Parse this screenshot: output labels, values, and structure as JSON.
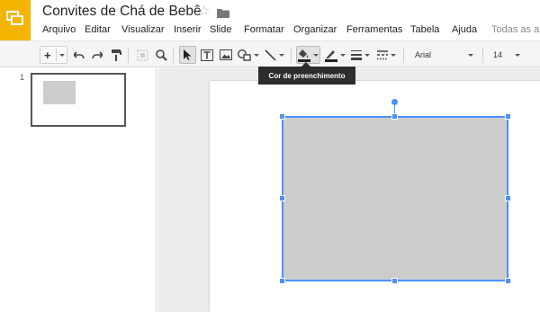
{
  "app": {
    "title": "Convites de Chá de Bebê"
  },
  "menu": {
    "items": [
      "Arquivo",
      "Editar",
      "Visualizar",
      "Inserir",
      "Slide",
      "Formatar",
      "Organizar",
      "Ferramentas",
      "Tabela",
      "Ajuda"
    ],
    "changes_status": "Todas as al"
  },
  "toolbar": {
    "add_label": "+",
    "font_name": "Arial",
    "font_size": "14"
  },
  "tooltip": {
    "text": "Cor de preenchimento"
  },
  "filmstrip": {
    "slide_number": "1"
  },
  "colors": {
    "accent": "#4d90fe",
    "logo": "#f4b400",
    "shape_fill": "#cdcdcd"
  },
  "icons": [
    "slides-logo-icon",
    "star-icon",
    "folder-icon",
    "undo-icon",
    "redo-icon",
    "paint-format-icon",
    "select-icon",
    "zoom-icon",
    "cursor-icon",
    "text-box-icon",
    "image-icon",
    "shape-icon",
    "line-icon",
    "fill-color-icon",
    "line-color-icon",
    "line-weight-icon",
    "line-dash-icon"
  ]
}
